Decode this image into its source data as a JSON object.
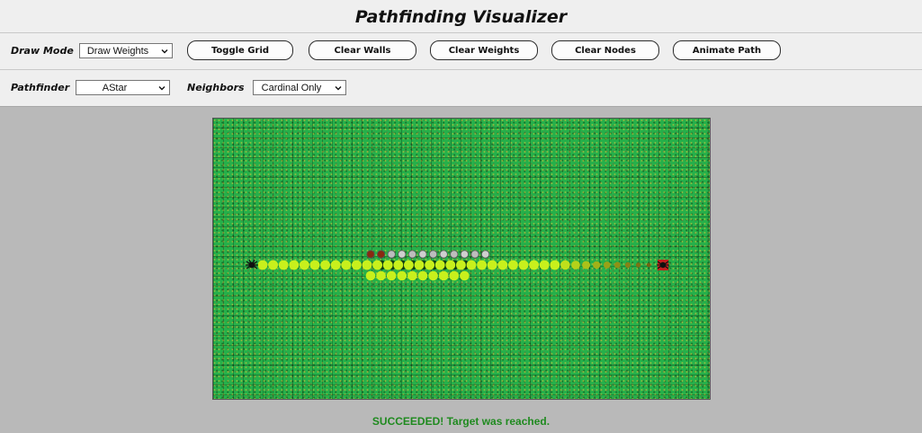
{
  "app": {
    "title": "Pathfinding Visualizer"
  },
  "toolbar": {
    "draw_mode_label": "Draw Mode",
    "draw_mode_value": "Draw Weights",
    "buttons": {
      "toggle_grid": "Toggle Grid",
      "clear_walls": "Clear Walls",
      "clear_weights": "Clear Weights",
      "clear_nodes": "Clear Nodes",
      "animate_path": "Animate Path"
    }
  },
  "settings": {
    "pathfinder_label": "Pathfinder",
    "pathfinder_value": "AStar",
    "neighbors_label": "Neighbors",
    "neighbors_value": "Cardinal Only"
  },
  "grid": {
    "path_color": "#c8f01c",
    "visited_color": "#0f3d12",
    "frontier_color": "#c9c9c9",
    "start_marker": "spider-icon",
    "target_marker": "target-icon"
  },
  "status": {
    "message": "SUCCEEDED! Target was reached.",
    "color": "#1f8a1f"
  }
}
